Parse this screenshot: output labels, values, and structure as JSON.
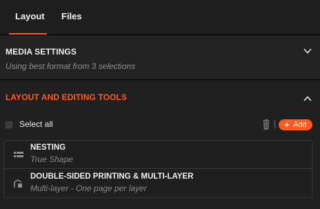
{
  "tabs": [
    {
      "label": "Layout",
      "active": true
    },
    {
      "label": "Files",
      "active": false
    }
  ],
  "media_settings": {
    "title": "MEDIA SETTINGS",
    "subtitle": "Using best format from 3 selections",
    "expanded": false
  },
  "layout_tools": {
    "title": "LAYOUT AND EDITING TOOLS",
    "expanded": true,
    "select_all_label": "Select all",
    "select_all_checked": false,
    "add_label": "Add",
    "items": [
      {
        "title": "NESTING",
        "subtitle": "True Shape",
        "icon": "nesting-icon"
      },
      {
        "title": "DOUBLE-SIDED PRINTING & MULTI-LAYER",
        "subtitle": "Multi-layer - One page per layer",
        "icon": "multi-layer-icon"
      }
    ]
  },
  "colors": {
    "accent": "#ff5a1f",
    "background": "#1b1b1b",
    "panel": "#232323"
  }
}
